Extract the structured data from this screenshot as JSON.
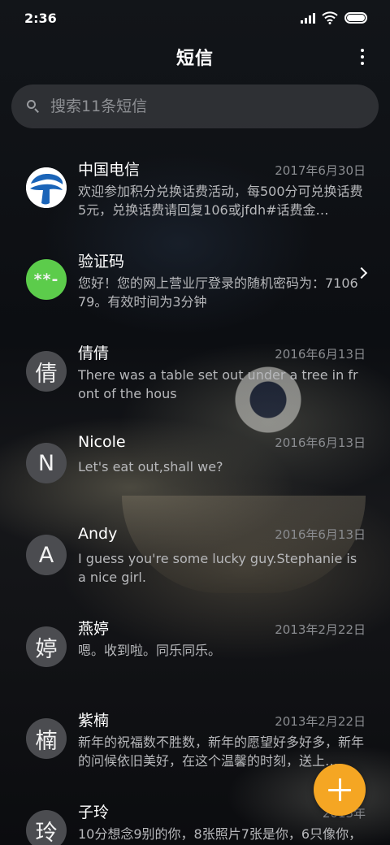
{
  "status": {
    "time": "2:36"
  },
  "header": {
    "title": "短信"
  },
  "search": {
    "placeholder": "搜索11条短信"
  },
  "conversations": [
    {
      "name": "中国电信",
      "date": "2017年6月30日",
      "snippet": "欢迎参加积分兑换话费活动，每500分可兑换话费5元，兑换话费请回复106或jfdh#话费金…",
      "avatar_type": "china-telecom-logo"
    },
    {
      "name": "验证码",
      "date": "",
      "snippet": "您好！您的网上营业厅登录的随机密码为：710679。有效时间为3分钟",
      "avatar_text": "**-",
      "avatar_color": "#5ccc4b",
      "has_chevron": true
    },
    {
      "name": "倩倩",
      "date": "2016年6月13日",
      "snippet": "There was a table set out under a tree in front of the hous",
      "avatar_text": "倩"
    },
    {
      "name": "Nicole",
      "date": "2016年6月13日",
      "snippet": "Let's eat out,shall we?",
      "avatar_text": "N"
    },
    {
      "name": "Andy",
      "date": "2016年6月13日",
      "snippet": "I guess you're some lucky guy.Stephanie is a nice girl.",
      "avatar_text": "A"
    },
    {
      "name": "燕婷",
      "date": "2013年2月22日",
      "snippet": "嗯。收到啦。同乐同乐。",
      "avatar_text": "婷"
    },
    {
      "name": "紫楠",
      "date": "2013年2月22日",
      "snippet": "新年的祝福数不胜数，新年的愿望好多好多，新年的问候依旧美好，在这个温馨的时刻，送上…",
      "avatar_text": "楠"
    },
    {
      "name": "子玲",
      "date": "2013年",
      "snippet": "10分想念9别的你，8张照片7张是你，6只像你，4根骨头3根归你，2爪着地1定是你，",
      "avatar_text": "玲"
    }
  ],
  "fab": {
    "icon": "plus-icon",
    "color": "#f5a623"
  },
  "colors": {
    "accent": "#f5a623",
    "verification_avatar": "#5ccc4b"
  }
}
